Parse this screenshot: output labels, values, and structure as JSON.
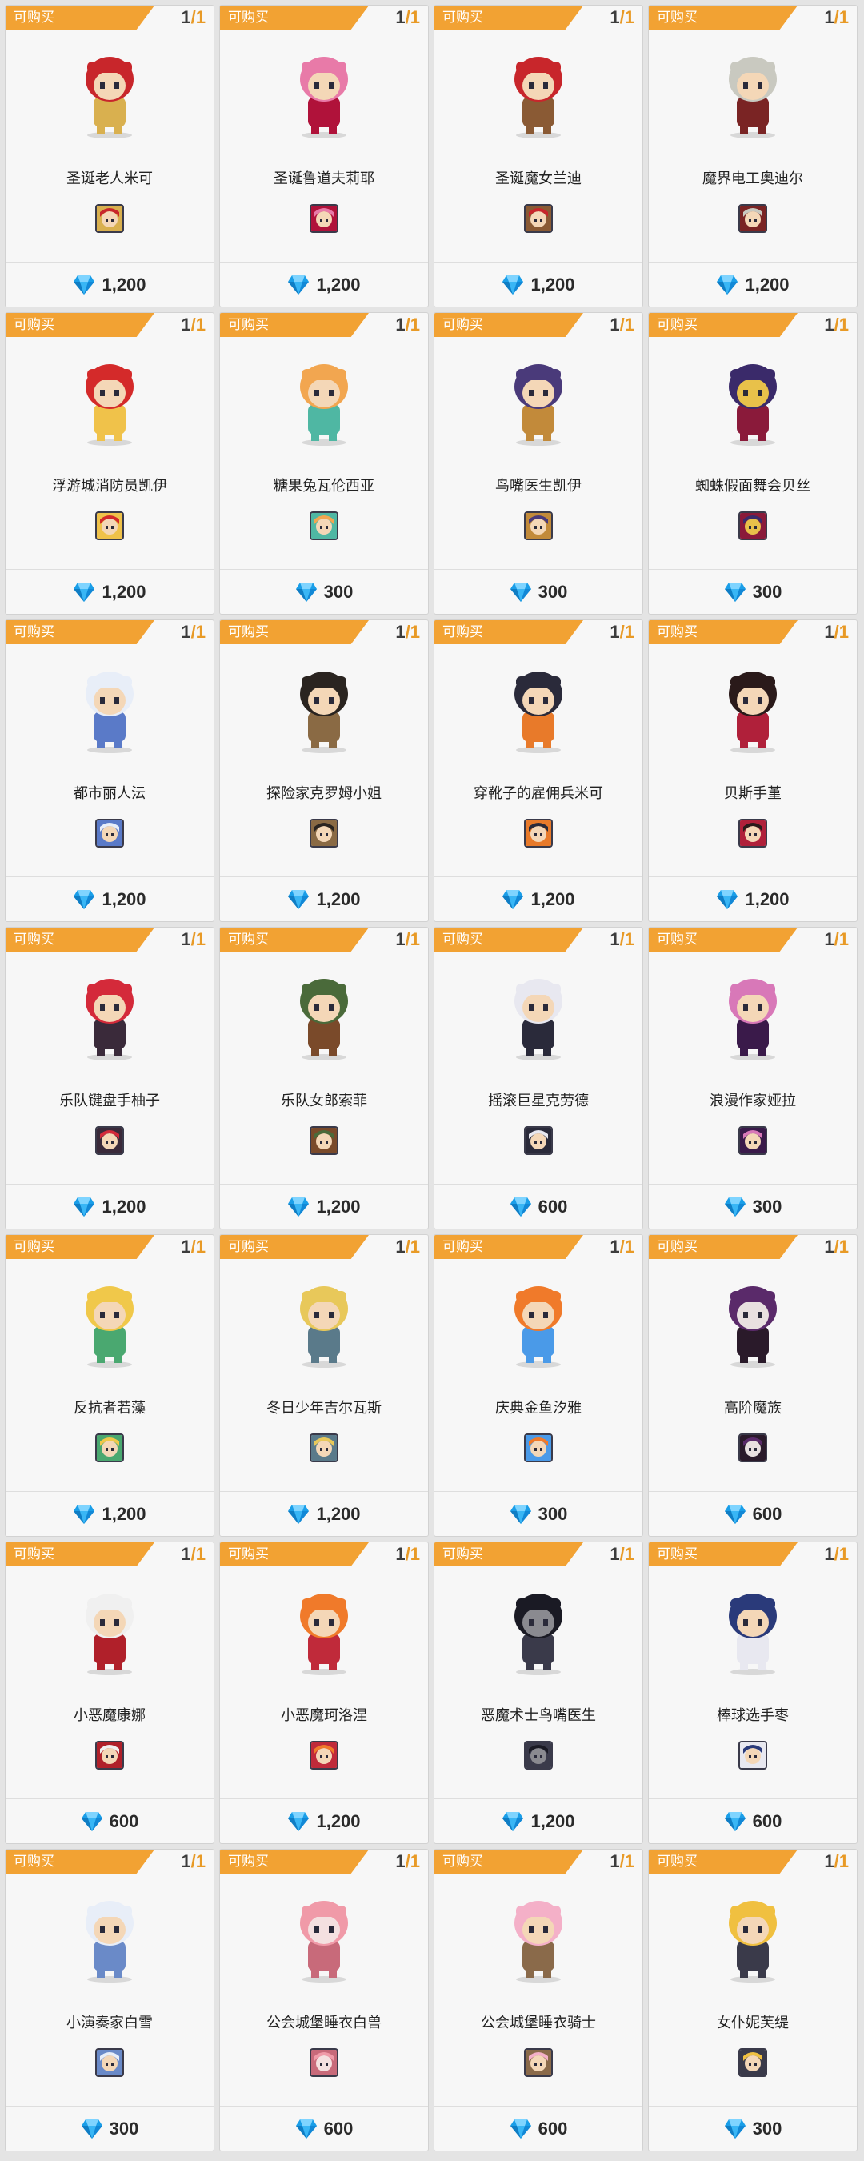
{
  "status_label": "可购买",
  "accent_color": "#f2a233",
  "price_icon": "diamond-icon",
  "items": [
    {
      "name": "圣诞老人米可",
      "owned": "1",
      "limit": "1",
      "price": "1,200",
      "colors": [
        "#c8262b",
        "#f4d7b7",
        "#d9b04f"
      ]
    },
    {
      "name": "圣诞鲁道夫莉耶",
      "owned": "1",
      "limit": "1",
      "price": "1,200",
      "colors": [
        "#e87aa8",
        "#f4d7b7",
        "#b0123a"
      ]
    },
    {
      "name": "圣诞魔女兰迪",
      "owned": "1",
      "limit": "1",
      "price": "1,200",
      "colors": [
        "#c8262b",
        "#f4d7b7",
        "#8a5a34"
      ]
    },
    {
      "name": "魔界电工奥迪尔",
      "owned": "1",
      "limit": "1",
      "price": "1,200",
      "colors": [
        "#c9c9c0",
        "#f4d7b7",
        "#7a2424"
      ]
    },
    {
      "name": "浮游城消防员凯伊",
      "owned": "1",
      "limit": "1",
      "price": "1,200",
      "colors": [
        "#d42a2a",
        "#f4d7b7",
        "#f0c24a"
      ]
    },
    {
      "name": "糖果兔瓦伦西亚",
      "owned": "1",
      "limit": "1",
      "price": "300",
      "colors": [
        "#f2a650",
        "#f4d7b7",
        "#4fb7a3"
      ]
    },
    {
      "name": "鸟嘴医生凯伊",
      "owned": "1",
      "limit": "1",
      "price": "300",
      "colors": [
        "#4a3a7a",
        "#f4d7b7",
        "#c28a3a"
      ]
    },
    {
      "name": "蜘蛛假面舞会贝丝",
      "owned": "1",
      "limit": "1",
      "price": "300",
      "colors": [
        "#3a2a6a",
        "#e8c14a",
        "#8a1a3a"
      ]
    },
    {
      "name": "都市丽人沄",
      "owned": "1",
      "limit": "1",
      "price": "1,200",
      "colors": [
        "#e8eef8",
        "#f4d7b7",
        "#5a7ac8"
      ]
    },
    {
      "name": "探险家克罗姆小姐",
      "owned": "1",
      "limit": "1",
      "price": "1,200",
      "colors": [
        "#2a2420",
        "#f4d7b7",
        "#8a6a44"
      ]
    },
    {
      "name": "穿靴子的雇佣兵米可",
      "owned": "1",
      "limit": "1",
      "price": "1,200",
      "colors": [
        "#2a2a3a",
        "#f4d7b7",
        "#e87a2a"
      ]
    },
    {
      "name": "贝斯手堇",
      "owned": "1",
      "limit": "1",
      "price": "1,200",
      "colors": [
        "#2a1a1a",
        "#f4d7b7",
        "#b0203a"
      ]
    },
    {
      "name": "乐队键盘手柚子",
      "owned": "1",
      "limit": "1",
      "price": "1,200",
      "colors": [
        "#d42a3a",
        "#f4d7b7",
        "#3a2a3a"
      ]
    },
    {
      "name": "乐队女郎索菲",
      "owned": "1",
      "limit": "1",
      "price": "1,200",
      "colors": [
        "#4a6a3a",
        "#f4d7b7",
        "#7a4a2a"
      ]
    },
    {
      "name": "摇滚巨星克劳德",
      "owned": "1",
      "limit": "1",
      "price": "600",
      "colors": [
        "#e8e8f0",
        "#f4d7b7",
        "#2a2a3a"
      ]
    },
    {
      "name": "浪漫作家娅拉",
      "owned": "1",
      "limit": "1",
      "price": "300",
      "colors": [
        "#d878b8",
        "#f4d7b7",
        "#3a1a4a"
      ]
    },
    {
      "name": "反抗者若藻",
      "owned": "1",
      "limit": "1",
      "price": "1,200",
      "colors": [
        "#f0c84a",
        "#f4d7b7",
        "#4aa870"
      ]
    },
    {
      "name": "冬日少年吉尔瓦斯",
      "owned": "1",
      "limit": "1",
      "price": "1,200",
      "colors": [
        "#e8c85a",
        "#f4d7b7",
        "#5a7a8a"
      ]
    },
    {
      "name": "庆典金鱼汐雅",
      "owned": "1",
      "limit": "1",
      "price": "300",
      "colors": [
        "#f07a2a",
        "#f4d7b7",
        "#4a9ae8"
      ]
    },
    {
      "name": "高阶魔族",
      "owned": "1",
      "limit": "1",
      "price": "600",
      "colors": [
        "#5a2a6a",
        "#e8e0e0",
        "#2a1a2a"
      ]
    },
    {
      "name": "小恶魔康娜",
      "owned": "1",
      "limit": "1",
      "price": "600",
      "colors": [
        "#f0f0f0",
        "#f4d7b7",
        "#b0202a"
      ]
    },
    {
      "name": "小恶魔珂洛涅",
      "owned": "1",
      "limit": "1",
      "price": "1,200",
      "colors": [
        "#f07a2a",
        "#f4d7b7",
        "#c02a3a"
      ]
    },
    {
      "name": "恶魔术士鸟嘴医生",
      "owned": "1",
      "limit": "1",
      "price": "1,200",
      "colors": [
        "#1a1a24",
        "#8a8a90",
        "#3a3a4a"
      ]
    },
    {
      "name": "棒球选手枣",
      "owned": "1",
      "limit": "1",
      "price": "600",
      "colors": [
        "#2a3a7a",
        "#f4d7b7",
        "#e8e8f0"
      ]
    },
    {
      "name": "小演奏家白雪",
      "owned": "1",
      "limit": "1",
      "price": "300",
      "colors": [
        "#e8eef8",
        "#f4d7b7",
        "#6a8ac8"
      ]
    },
    {
      "name": "公会城堡睡衣白兽",
      "owned": "1",
      "limit": "1",
      "price": "600",
      "colors": [
        "#f09aa8",
        "#f4e0e0",
        "#c86a7a"
      ]
    },
    {
      "name": "公会城堡睡衣骑士",
      "owned": "1",
      "limit": "1",
      "price": "600",
      "colors": [
        "#f4b0c8",
        "#f4d7b7",
        "#8a6a4a"
      ]
    },
    {
      "name": "女仆妮芙缇",
      "owned": "1",
      "limit": "1",
      "price": "300",
      "colors": [
        "#f0c040",
        "#f4d7b7",
        "#3a3a4a"
      ]
    }
  ]
}
